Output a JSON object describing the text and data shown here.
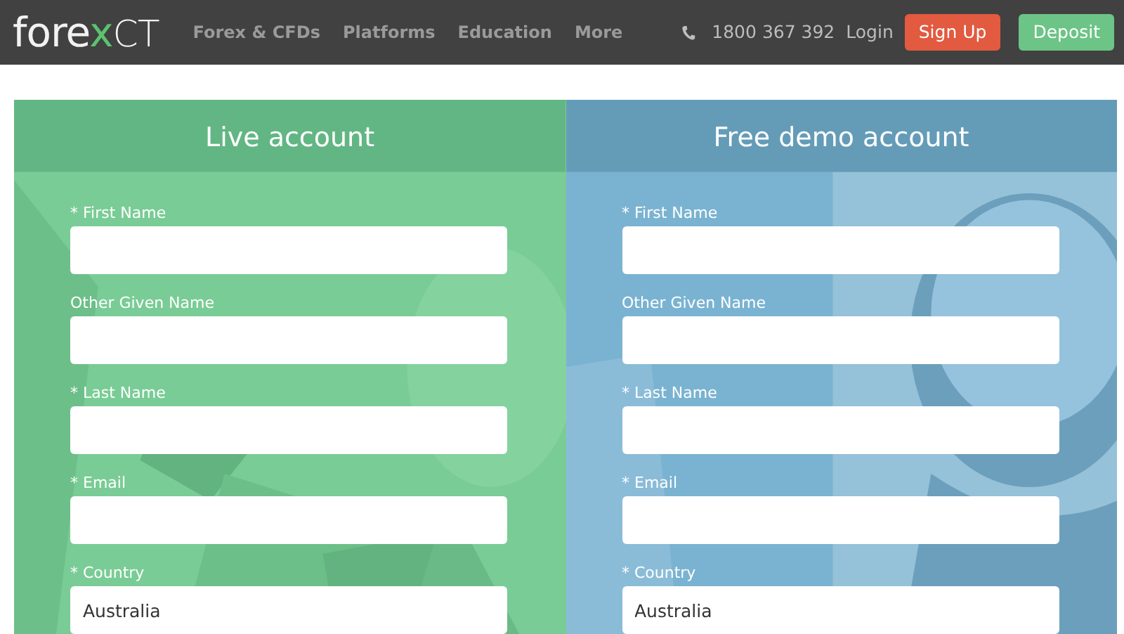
{
  "navbar": {
    "logo": {
      "prefix": "fore",
      "accent": "x",
      "suffix": "CT"
    },
    "menu": [
      "Forex & CFDs",
      "Platforms",
      "Education",
      "More"
    ],
    "phone": "1800 367 392",
    "login": "Login",
    "buttons": [
      {
        "kind": "signup",
        "label": "Sign Up"
      },
      {
        "kind": "deposit",
        "label": "Deposit"
      }
    ]
  },
  "panels": [
    {
      "kind": "live",
      "title": "Live account",
      "fields": [
        {
          "label": "* First Name"
        },
        {
          "label": "Other Given Name"
        },
        {
          "label": "* Last Name"
        },
        {
          "label": "* Email"
        },
        {
          "label": "* Country",
          "value": "Australia"
        }
      ]
    },
    {
      "kind": "demo",
      "title": "Free demo account",
      "fields": [
        {
          "label": "* First Name"
        },
        {
          "label": "Other Given Name"
        },
        {
          "label": "* Last Name"
        },
        {
          "label": "* Email"
        },
        {
          "label": "* Country",
          "value": "Australia"
        }
      ]
    }
  ]
}
